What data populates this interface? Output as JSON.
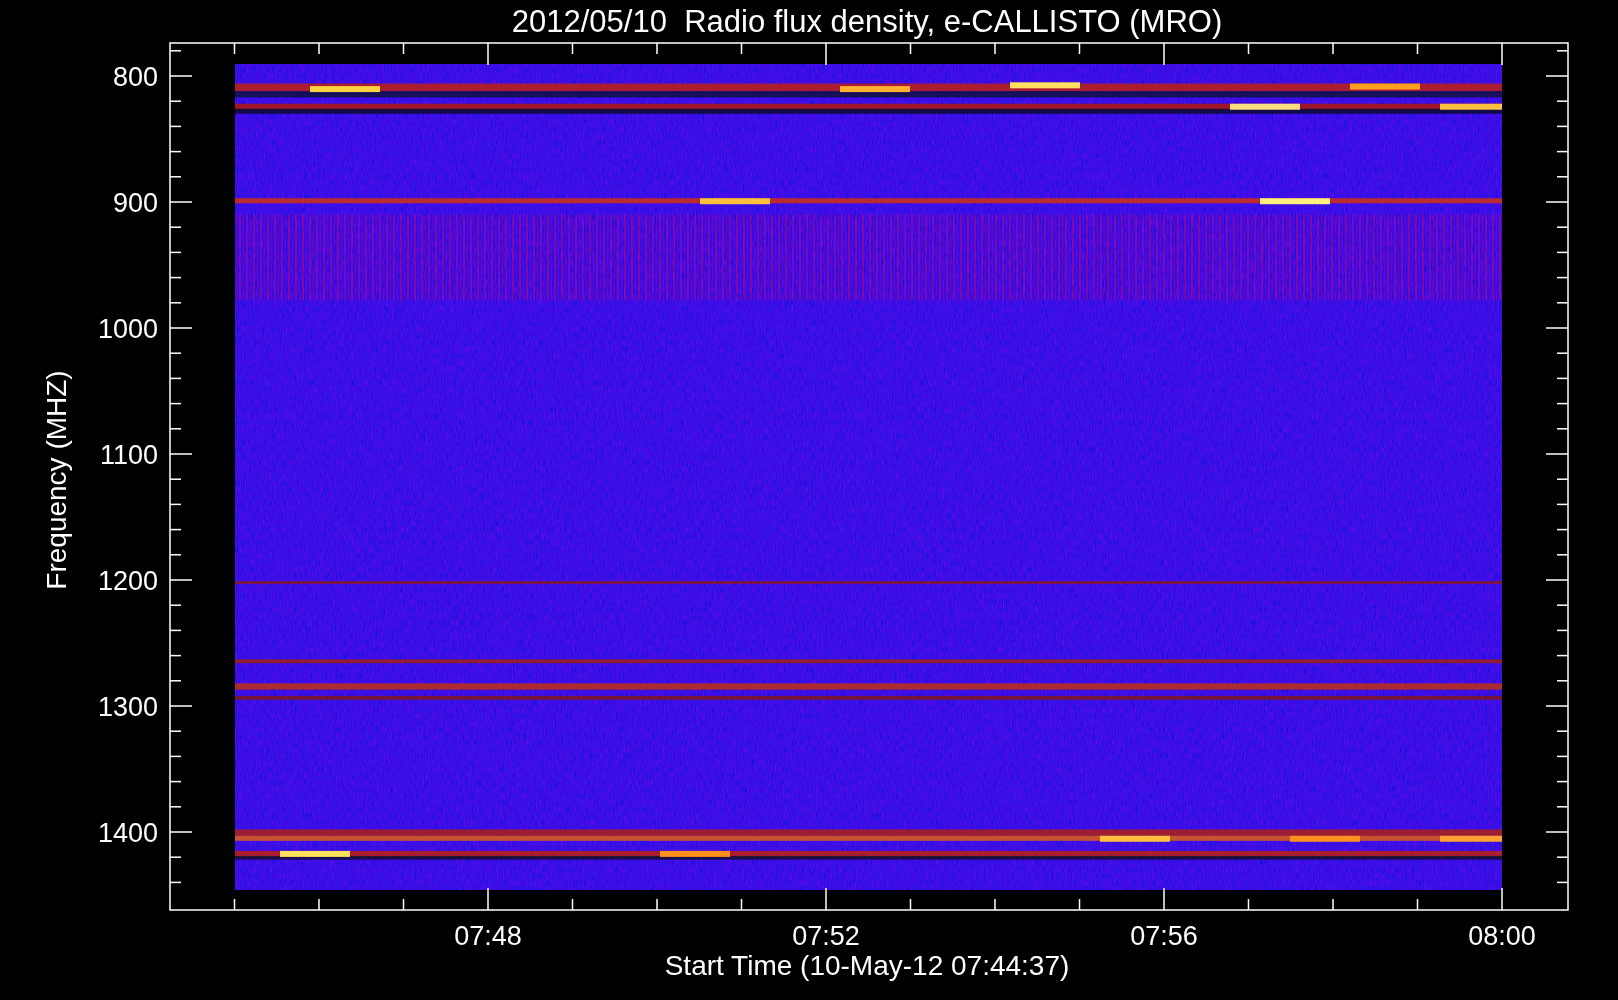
{
  "chart": {
    "title": "2012/05/10  Radio flux density, e-CALLISTO (MRO)",
    "ylabel": "Frequency (MHZ)",
    "xlabel": "Start Time (10-May-12 07:44:37)",
    "yticks": [
      "800",
      "900",
      "1000",
      "1100",
      "1200",
      "1300",
      "1400"
    ],
    "xticks": [
      "07:48",
      "07:52",
      "07:56",
      "08:00"
    ]
  }
}
